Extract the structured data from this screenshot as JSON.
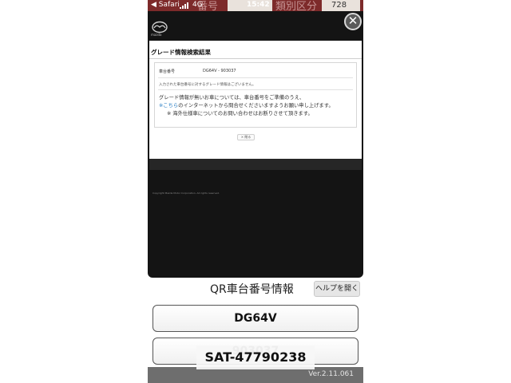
{
  "status_bar": {
    "back_label": "◀ Safari",
    "network": "4G",
    "time": "15:42",
    "battery": "728",
    "bg_texts": [
      "番号",
      "類別区分"
    ]
  },
  "webview": {
    "close_icon": "close-icon",
    "brand": "mazda",
    "page_title": "グレード情報検索結果",
    "row_label": "車台番号",
    "row_value": "DG64V - 903037",
    "no_grade_text": "入力された車台番号に対するグレード情報はございません。",
    "note_line1": "グレード情報が無いお車については、車台番号をご準備のうえ、",
    "note_link": "※こちら",
    "note_line2_rest": "のインターネットから問合せくださいますようお願い申し上げます。",
    "note_line3": "※ 海外仕様車についてのお問い合わせはお断りさせて頂きます。",
    "back_button": "× 閉る",
    "copyright": "Copyright Mazda Motor Corporation. All rights reserved."
  },
  "native": {
    "title": "QR車台番号情報",
    "help_button": "ヘルプを開く",
    "model_code": "DG64V",
    "serial_number": "903037",
    "version": "Ver.2.11.061"
  },
  "overlay_label": "SAT-47790238",
  "colors": {
    "header_red": "#7d2a2a",
    "link_blue": "#2a7fc4",
    "webview_bg": "#141414"
  }
}
